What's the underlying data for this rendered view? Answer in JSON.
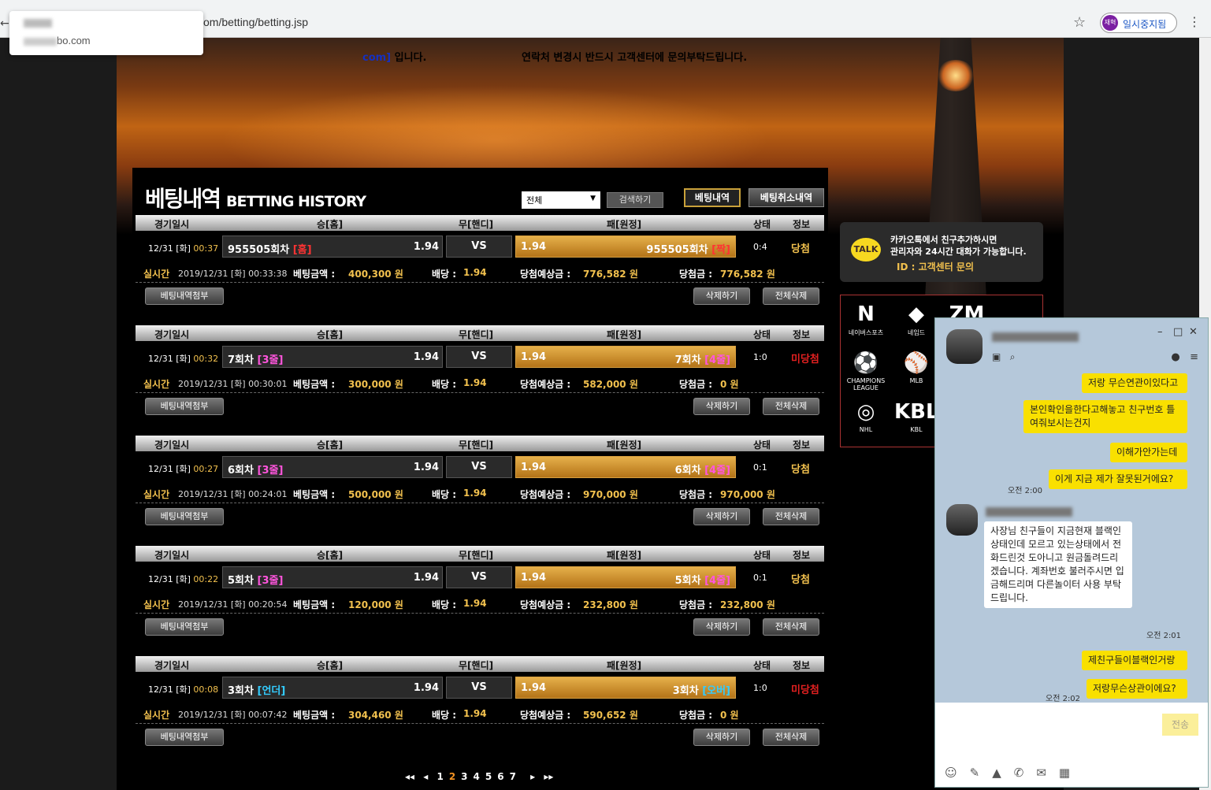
{
  "browser": {
    "url": "om/betting/betting.jsp",
    "tab_domain": "bo.com",
    "profile_label": "일시중지됨",
    "profile_initials": "재혁",
    "star_icon": "star-icon",
    "menu_icon": "kebab-icon"
  },
  "notices": {
    "left_prefix": "com]",
    "left_suffix": "입니다.",
    "right": "연락처 변경시 반드시 고객센터에 문의부탁드립니다."
  },
  "header": {
    "title_ko": "베팅내역",
    "title_en": "BETTING HISTORY",
    "filter_value": "전체",
    "search_label": "검색하기",
    "history_label": "베팅내역",
    "cancel_history_label": "베팅취소내역"
  },
  "columns": {
    "date": "경기일시",
    "home": "승[홈]",
    "draw": "무[핸디]",
    "away": "패[원정]",
    "status": "상태",
    "info": "정보"
  },
  "labels": {
    "realtime": "실시간",
    "bet_amount": "베팅금액 :",
    "odds": "배당 :",
    "expected": "당첨예상금 :",
    "won": "당첨금 :",
    "attach": "베팅내역첨부",
    "delete": "삭제하기",
    "delete_all": "전체삭제",
    "vs": "VS"
  },
  "bets": [
    {
      "date": "12/31 [화]",
      "time": "00:37",
      "home_name": "955505회차",
      "home_tag": "[홈]",
      "home_odds": "1.94",
      "away_odds": "1.94",
      "away_name": "955505회차",
      "away_tag": "[짝]",
      "score": "0:4",
      "result": "당첨",
      "rt_date": "2019/12/31 [화] 00:33:38",
      "amount": "400,300 원",
      "odds": "1.94",
      "expected": "776,582 원",
      "won": "776,582 원"
    },
    {
      "date": "12/31 [화]",
      "time": "00:32",
      "home_name": "7회차",
      "home_tag": "[3줄]",
      "home_odds": "1.94",
      "away_odds": "1.94",
      "away_name": "7회차",
      "away_tag": "[4줄]",
      "score": "1:0",
      "result": "미당첨",
      "rt_date": "2019/12/31 [화] 00:30:01",
      "amount": "300,000 원",
      "odds": "1.94",
      "expected": "582,000 원",
      "won": "0 원"
    },
    {
      "date": "12/31 [화]",
      "time": "00:27",
      "home_name": "6회차",
      "home_tag": "[3줄]",
      "home_odds": "1.94",
      "away_odds": "1.94",
      "away_name": "6회차",
      "away_tag": "[4줄]",
      "score": "0:1",
      "result": "당첨",
      "rt_date": "2019/12/31 [화] 00:24:01",
      "amount": "500,000 원",
      "odds": "1.94",
      "expected": "970,000 원",
      "won": "970,000 원"
    },
    {
      "date": "12/31 [화]",
      "time": "00:22",
      "home_name": "5회차",
      "home_tag": "[3줄]",
      "home_odds": "1.94",
      "away_odds": "1.94",
      "away_name": "5회차",
      "away_tag": "[4줄]",
      "score": "0:1",
      "result": "당첨",
      "rt_date": "2019/12/31 [화] 00:20:54",
      "amount": "120,000 원",
      "odds": "1.94",
      "expected": "232,800 원",
      "won": "232,800 원"
    },
    {
      "date": "12/31 [화]",
      "time": "00:08",
      "home_name": "3회차",
      "home_tag": "[언더]",
      "home_odds": "1.94",
      "away_odds": "1.94",
      "away_name": "3회차",
      "away_tag": "[오버]",
      "score": "1:0",
      "result": "미당첨",
      "rt_date": "2019/12/31 [화] 00:07:42",
      "amount": "304,460 원",
      "odds": "1.94",
      "expected": "590,652 원",
      "won": "0 원"
    }
  ],
  "pager": {
    "first": "◂◂",
    "prev": "◂",
    "pages": [
      "1",
      "2",
      "3",
      "4",
      "5",
      "6",
      "7"
    ],
    "current": "2",
    "next": "▸",
    "last": "▸▸"
  },
  "kakao": {
    "badge": "TALK",
    "line1": "카카오톡에서 친구추가하시면",
    "line2": "관리자와 24시간 대화가 가능합니다.",
    "line3": "ID : 고객센터 문의"
  },
  "sports": [
    {
      "icon": "N",
      "label": "네이버스포츠"
    },
    {
      "icon": "◆",
      "label": "네임드"
    },
    {
      "icon": "ZM",
      "label": ""
    },
    {
      "icon": "⚽",
      "label": "CHAMPIONS LEAGUE"
    },
    {
      "icon": "⚾",
      "label": "MLB"
    },
    {
      "icon": "◎",
      "label": "NHL"
    },
    {
      "icon": "KBL",
      "label": "KBL"
    }
  ],
  "chat": {
    "messages": [
      {
        "text": "저랑 무슨연관이있다고"
      },
      {
        "text": "본인확인을한다고해놓고 친구번호 틀여줘보시는건지"
      },
      {
        "text": "이해가안가는데"
      },
      {
        "text": "이게 지금 제가 잘못된거에요?",
        "time": "오전 2:00"
      },
      {
        "text": "사장님 친구들이 지금현재 블랙인 상태인데 모르고 있는상태에서 전화드린것 도아니고 원금돌려드리겠습니다. 계좌번호 불러주시면 입금해드리며 다른놀이터 사용 부탁드립니다.",
        "time": "오전 2:01"
      },
      {
        "text": "제친구들이블랙인거랑"
      },
      {
        "text": "저랑무슨상관이에요?",
        "time": "오전 2:02"
      }
    ],
    "send_label": "전송"
  }
}
